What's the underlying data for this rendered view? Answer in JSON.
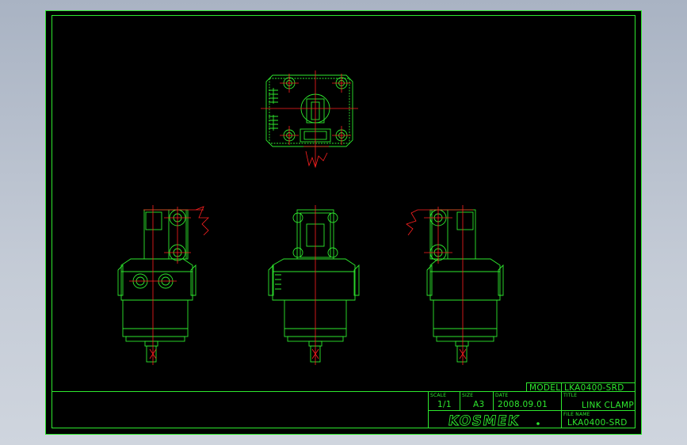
{
  "title_block": {
    "model_label": "MODEL",
    "model_value": "LKA0400-SRD",
    "scale_label": "SCALE",
    "scale_value": "1/1",
    "size_label": "SIZE",
    "size_value": "A3",
    "date_label": "DATE",
    "date_value": "2008.09.01",
    "title_label": "TITLE",
    "title_value": "LINK CLAMP",
    "file_label": "FILE NAME",
    "file_value": "LKA0400-SRD",
    "company": "KOSMEK"
  },
  "colors": {
    "outline": "#2ee82e",
    "centerline": "#ff2020",
    "sheet": "#000000",
    "background": "#b8c0cd"
  }
}
